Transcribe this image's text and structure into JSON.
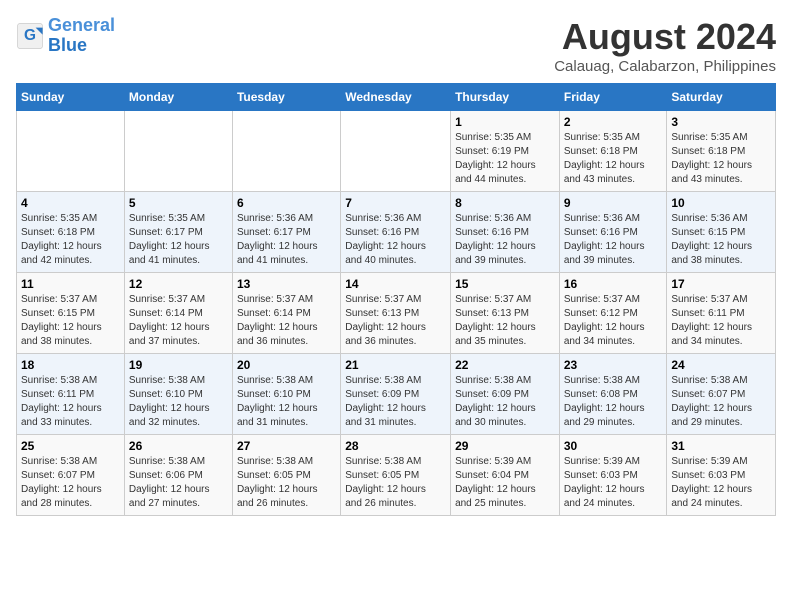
{
  "logo": {
    "line1": "General",
    "line2": "Blue"
  },
  "title": "August 2024",
  "location": "Calauag, Calabarzon, Philippines",
  "weekdays": [
    "Sunday",
    "Monday",
    "Tuesday",
    "Wednesday",
    "Thursday",
    "Friday",
    "Saturday"
  ],
  "weeks": [
    [
      {
        "day": "",
        "info": ""
      },
      {
        "day": "",
        "info": ""
      },
      {
        "day": "",
        "info": ""
      },
      {
        "day": "",
        "info": ""
      },
      {
        "day": "1",
        "info": "Sunrise: 5:35 AM\nSunset: 6:19 PM\nDaylight: 12 hours\nand 44 minutes."
      },
      {
        "day": "2",
        "info": "Sunrise: 5:35 AM\nSunset: 6:18 PM\nDaylight: 12 hours\nand 43 minutes."
      },
      {
        "day": "3",
        "info": "Sunrise: 5:35 AM\nSunset: 6:18 PM\nDaylight: 12 hours\nand 43 minutes."
      }
    ],
    [
      {
        "day": "4",
        "info": "Sunrise: 5:35 AM\nSunset: 6:18 PM\nDaylight: 12 hours\nand 42 minutes."
      },
      {
        "day": "5",
        "info": "Sunrise: 5:35 AM\nSunset: 6:17 PM\nDaylight: 12 hours\nand 41 minutes."
      },
      {
        "day": "6",
        "info": "Sunrise: 5:36 AM\nSunset: 6:17 PM\nDaylight: 12 hours\nand 41 minutes."
      },
      {
        "day": "7",
        "info": "Sunrise: 5:36 AM\nSunset: 6:16 PM\nDaylight: 12 hours\nand 40 minutes."
      },
      {
        "day": "8",
        "info": "Sunrise: 5:36 AM\nSunset: 6:16 PM\nDaylight: 12 hours\nand 39 minutes."
      },
      {
        "day": "9",
        "info": "Sunrise: 5:36 AM\nSunset: 6:16 PM\nDaylight: 12 hours\nand 39 minutes."
      },
      {
        "day": "10",
        "info": "Sunrise: 5:36 AM\nSunset: 6:15 PM\nDaylight: 12 hours\nand 38 minutes."
      }
    ],
    [
      {
        "day": "11",
        "info": "Sunrise: 5:37 AM\nSunset: 6:15 PM\nDaylight: 12 hours\nand 38 minutes."
      },
      {
        "day": "12",
        "info": "Sunrise: 5:37 AM\nSunset: 6:14 PM\nDaylight: 12 hours\nand 37 minutes."
      },
      {
        "day": "13",
        "info": "Sunrise: 5:37 AM\nSunset: 6:14 PM\nDaylight: 12 hours\nand 36 minutes."
      },
      {
        "day": "14",
        "info": "Sunrise: 5:37 AM\nSunset: 6:13 PM\nDaylight: 12 hours\nand 36 minutes."
      },
      {
        "day": "15",
        "info": "Sunrise: 5:37 AM\nSunset: 6:13 PM\nDaylight: 12 hours\nand 35 minutes."
      },
      {
        "day": "16",
        "info": "Sunrise: 5:37 AM\nSunset: 6:12 PM\nDaylight: 12 hours\nand 34 minutes."
      },
      {
        "day": "17",
        "info": "Sunrise: 5:37 AM\nSunset: 6:11 PM\nDaylight: 12 hours\nand 34 minutes."
      }
    ],
    [
      {
        "day": "18",
        "info": "Sunrise: 5:38 AM\nSunset: 6:11 PM\nDaylight: 12 hours\nand 33 minutes."
      },
      {
        "day": "19",
        "info": "Sunrise: 5:38 AM\nSunset: 6:10 PM\nDaylight: 12 hours\nand 32 minutes."
      },
      {
        "day": "20",
        "info": "Sunrise: 5:38 AM\nSunset: 6:10 PM\nDaylight: 12 hours\nand 31 minutes."
      },
      {
        "day": "21",
        "info": "Sunrise: 5:38 AM\nSunset: 6:09 PM\nDaylight: 12 hours\nand 31 minutes."
      },
      {
        "day": "22",
        "info": "Sunrise: 5:38 AM\nSunset: 6:09 PM\nDaylight: 12 hours\nand 30 minutes."
      },
      {
        "day": "23",
        "info": "Sunrise: 5:38 AM\nSunset: 6:08 PM\nDaylight: 12 hours\nand 29 minutes."
      },
      {
        "day": "24",
        "info": "Sunrise: 5:38 AM\nSunset: 6:07 PM\nDaylight: 12 hours\nand 29 minutes."
      }
    ],
    [
      {
        "day": "25",
        "info": "Sunrise: 5:38 AM\nSunset: 6:07 PM\nDaylight: 12 hours\nand 28 minutes."
      },
      {
        "day": "26",
        "info": "Sunrise: 5:38 AM\nSunset: 6:06 PM\nDaylight: 12 hours\nand 27 minutes."
      },
      {
        "day": "27",
        "info": "Sunrise: 5:38 AM\nSunset: 6:05 PM\nDaylight: 12 hours\nand 26 minutes."
      },
      {
        "day": "28",
        "info": "Sunrise: 5:38 AM\nSunset: 6:05 PM\nDaylight: 12 hours\nand 26 minutes."
      },
      {
        "day": "29",
        "info": "Sunrise: 5:39 AM\nSunset: 6:04 PM\nDaylight: 12 hours\nand 25 minutes."
      },
      {
        "day": "30",
        "info": "Sunrise: 5:39 AM\nSunset: 6:03 PM\nDaylight: 12 hours\nand 24 minutes."
      },
      {
        "day": "31",
        "info": "Sunrise: 5:39 AM\nSunset: 6:03 PM\nDaylight: 12 hours\nand 24 minutes."
      }
    ]
  ]
}
